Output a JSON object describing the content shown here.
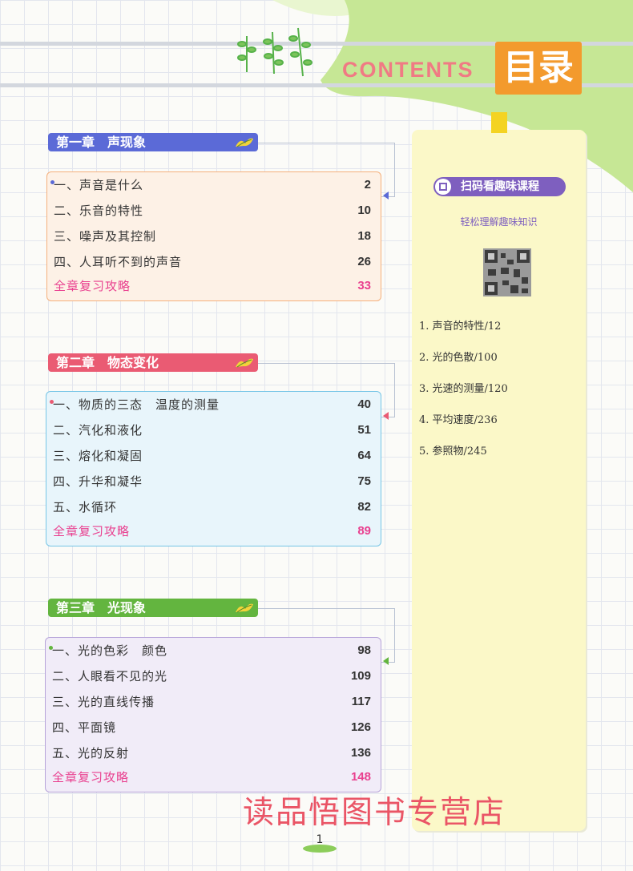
{
  "header": {
    "contents_word": "CONTENTS",
    "title": "目录"
  },
  "chapters": [
    {
      "title": "第一章　声现象",
      "color": "#5b6ad7",
      "box_border": "#f5b07c",
      "box_bg": "#fdf1e6",
      "items": [
        {
          "label": "一、声音是什么",
          "page": "2"
        },
        {
          "label": "二、乐音的特性",
          "page": "10"
        },
        {
          "label": "三、噪声及其控制",
          "page": "18"
        },
        {
          "label": "四、人耳听不到的声音",
          "page": "26"
        }
      ],
      "review": {
        "label": "全章复习攻略",
        "page": "33"
      }
    },
    {
      "title": "第二章　物态变化",
      "color": "#ea5b73",
      "box_border": "#76c5e6",
      "box_bg": "#e8f5fb",
      "items": [
        {
          "label": "一、物质的三态　温度的测量",
          "page": "40"
        },
        {
          "label": "二、汽化和液化",
          "page": "51"
        },
        {
          "label": "三、熔化和凝固",
          "page": "64"
        },
        {
          "label": "四、升华和凝华",
          "page": "75"
        },
        {
          "label": "五、水循环",
          "page": "82"
        }
      ],
      "review": {
        "label": "全章复习攻略",
        "page": "89"
      }
    },
    {
      "title": "第三章　光现象",
      "color": "#63b53f",
      "box_border": "#b7a4d9",
      "box_bg": "#f1ecf8",
      "items": [
        {
          "label": "一、光的色彩　颜色",
          "page": "98"
        },
        {
          "label": "二、人眼看不见的光",
          "page": "109"
        },
        {
          "label": "三、光的直线传播",
          "page": "117"
        },
        {
          "label": "四、平面镜",
          "page": "126"
        },
        {
          "label": "五、光的反射",
          "page": "136"
        }
      ],
      "review": {
        "label": "全章复习攻略",
        "page": "148"
      }
    }
  ],
  "side_panel": {
    "scan_label": "扫码看趣味课程",
    "subtitle": "轻松理解趣味知识",
    "lessons": [
      "1. 声音的特性/12",
      "2. 光的色散/100",
      "3. 光速的测量/120",
      "4. 平均速度/236",
      "5. 参照物/245"
    ]
  },
  "watermark": "读品悟图书专营店",
  "page_number": "1"
}
